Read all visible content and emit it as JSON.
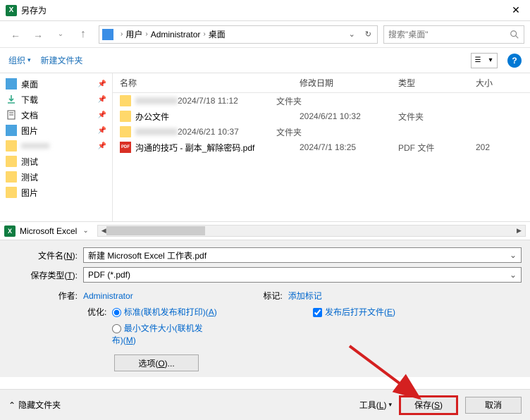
{
  "title": "另存为",
  "breadcrumb": {
    "items": [
      "用户",
      "Administrator",
      "桌面"
    ]
  },
  "search": {
    "placeholder": "搜索\"桌面\""
  },
  "toolbar": {
    "organize": "组织",
    "newfolder": "新建文件夹"
  },
  "sidebar": {
    "items": [
      {
        "label": "桌面",
        "pin": true
      },
      {
        "label": "下载",
        "pin": true
      },
      {
        "label": "文档",
        "pin": true
      },
      {
        "label": "图片",
        "pin": true
      },
      {
        "label": "",
        "pin": true
      },
      {
        "label": "测试",
        "pin": false
      },
      {
        "label": "测试",
        "pin": false
      },
      {
        "label": "图片",
        "pin": false
      }
    ]
  },
  "columns": {
    "name": "名称",
    "date": "修改日期",
    "type": "类型",
    "size": "大小"
  },
  "files": [
    {
      "name": "",
      "date": "2024/7/18 11:12",
      "type": "文件夹",
      "size": "",
      "icon": "folder",
      "blur": true
    },
    {
      "name": "办公文件",
      "date": "2024/6/21 10:32",
      "type": "文件夹",
      "size": "",
      "icon": "folder"
    },
    {
      "name": "",
      "date": "2024/6/21 10:37",
      "type": "文件夹",
      "size": "",
      "icon": "folder",
      "blur": true
    },
    {
      "name": "沟通的技巧 - 副本_解除密码.pdf",
      "date": "2024/7/1 18:25",
      "type": "PDF 文件",
      "size": "202",
      "icon": "pdf"
    }
  ],
  "excel_location": "Microsoft Excel",
  "filename": {
    "label": "文件名(N):",
    "value": "新建 Microsoft Excel 工作表.pdf"
  },
  "filetype": {
    "label": "保存类型(T):",
    "value": "PDF (*.pdf)"
  },
  "author": {
    "label": "作者:",
    "value": "Administrator"
  },
  "tags": {
    "label": "标记:",
    "value": "添加标记"
  },
  "optimize": {
    "label": "优化:",
    "opt1": "标准(联机发布和打印)(A)",
    "opt2": "最小文件大小(联机发布)(M)"
  },
  "openafter": "发布后打开文件(E)",
  "options_btn": "选项(O)...",
  "hide_folders": "隐藏文件夹",
  "tools": "工具(L)",
  "save": "保存(S)",
  "cancel": "取消"
}
